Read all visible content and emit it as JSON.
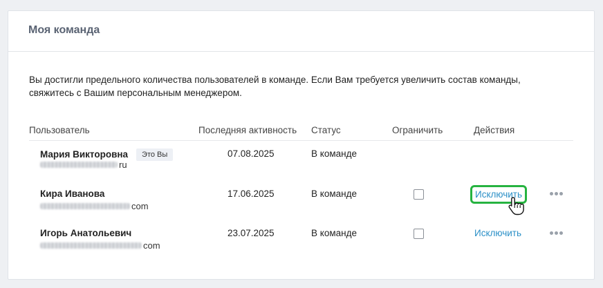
{
  "card": {
    "title": "Моя команда",
    "notice_line1": "Вы достигли предельного количества пользователей в команде. Если Вам требуется увеличить состав команды,",
    "notice_line2": "свяжитесь с Вашим персональным менеджером."
  },
  "table": {
    "headers": {
      "user": "Пользователь",
      "last_activity": "Последняя активность",
      "status": "Статус",
      "restrict": "Ограничить",
      "actions": "Действия"
    },
    "rows": [
      {
        "name": "Мария Викторовна",
        "badge": "Это Вы",
        "email_suffix": "ru",
        "last_activity": "07.08.2025",
        "status": "В команде"
      },
      {
        "name": "Кира Иванова",
        "email_suffix": "com",
        "last_activity": "17.06.2025",
        "status": "В команде",
        "restricted": false,
        "action": "Исключить"
      },
      {
        "name": "Игорь Анатольевич",
        "email_suffix": "com",
        "last_activity": "23.07.2025",
        "status": "В команде",
        "restricted": false,
        "action": "Исключить"
      }
    ]
  },
  "icons": {
    "more": "more-horizontal-icon",
    "cursor": "hand-pointer-icon"
  },
  "colors": {
    "link": "#2a8fc7",
    "highlight": "#26b340",
    "title": "#5a6373"
  }
}
